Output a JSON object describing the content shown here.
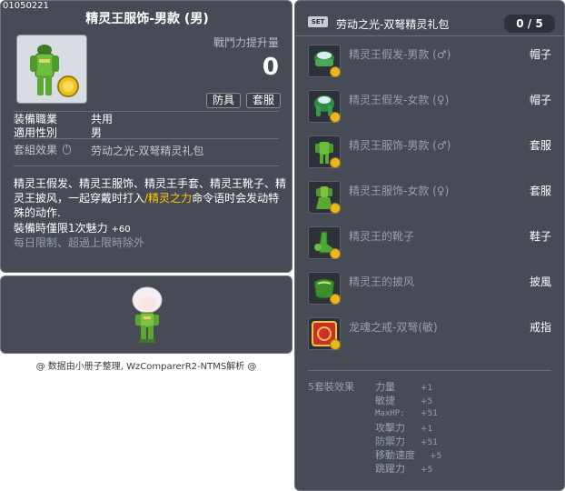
{
  "item": {
    "code": "01050221",
    "title": "精灵王服饰-男款 (男)",
    "power_label": "戰鬥力提升量",
    "power_value": "0",
    "tags": [
      "防具",
      "套服"
    ],
    "rows": [
      {
        "label": "装備職業",
        "value": "共用"
      },
      {
        "label": "適用性別",
        "value": "男"
      }
    ],
    "set_effect_label": "套組效果",
    "set_effect_value": "劳动之光-双弩精灵礼包",
    "description_before": "精灵王假发、精灵王服饰、精灵王手套、精灵王靴子、精灵王披风，一起穿戴时打入",
    "description_highlight": "/精灵之力",
    "description_after": "命令语时会发动特殊的动作.",
    "charm_label": "裝備時僅限1次魅力",
    "charm_value": "+60",
    "daily_limit": "每日限制、超過上限時除外"
  },
  "footer": "@ 数据由小册子整理, WzComparerR2-NTMS解析 @",
  "set": {
    "badge": "SET",
    "name": "劳动之光-双弩精灵礼包",
    "count": "0 / 5",
    "items": [
      {
        "name": "精灵王假发-男款 (♂)",
        "type": "帽子",
        "icon": "green-helmet-icon"
      },
      {
        "name": "精灵王假发-女款 (♀)",
        "type": "帽子",
        "icon": "green-hair-icon"
      },
      {
        "name": "精灵王服饰-男款 (♂)",
        "type": "套服",
        "icon": "green-suit-icon"
      },
      {
        "name": "精灵王服饰-女款 (♀)",
        "type": "套服",
        "icon": "green-dress-icon"
      },
      {
        "name": "精灵王的靴子",
        "type": "鞋子",
        "icon": "green-boots-icon"
      },
      {
        "name": "精灵王的披风",
        "type": "披風",
        "icon": "green-cape-icon"
      },
      {
        "name": "龙魂之戒-双弩(敏)",
        "type": "戒指",
        "icon": "red-ring-icon"
      }
    ],
    "effects_title": "5套裝效果",
    "effects": [
      {
        "label": "力量",
        "value": "+1"
      },
      {
        "label": "敏捷",
        "value": "+5"
      },
      {
        "label": "MaxHP:",
        "value": "+51"
      },
      {
        "label": "攻擊力",
        "value": "+1"
      },
      {
        "label": "防禦力",
        "value": "+51"
      },
      {
        "label": "移動速度",
        "value": "+5"
      },
      {
        "label": "跳躍力",
        "value": "+5"
      }
    ]
  },
  "colors": {
    "panel": "#464b55",
    "highlight": "#ffcc00",
    "muted": "#9aa0a8"
  }
}
